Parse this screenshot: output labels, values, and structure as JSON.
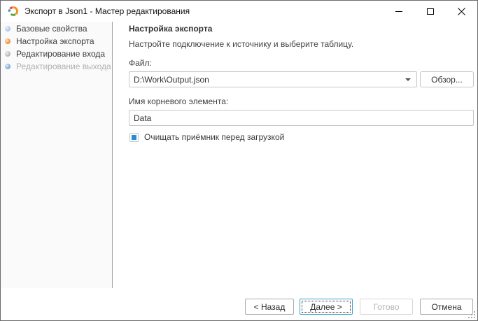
{
  "titlebar": {
    "title": "Экспорт в Json1 - Мастер редактирования",
    "icons": {
      "app": "app-logo-icon",
      "minimize": "minimize-icon",
      "maximize": "maximize-icon",
      "close": "close-icon"
    }
  },
  "sidebar": {
    "items": [
      {
        "label": "Базовые свойства",
        "state": "visited",
        "dot_color": "#a9c5e4"
      },
      {
        "label": "Настройка экспорта",
        "state": "current",
        "dot_color": "#ee8f2e"
      },
      {
        "label": "Редактирование входа",
        "state": "upcoming",
        "dot_color": "#b5b5b5"
      },
      {
        "label": "Редактирование выхода",
        "state": "disabled",
        "dot_color": "#79a9d9"
      }
    ]
  },
  "content": {
    "heading": "Настройка экспорта",
    "subtitle": "Настройте подключение к источнику и выберите таблицу.",
    "file_field": {
      "label": "Файл:",
      "value": "D:\\Work\\Output.json",
      "browse_label": "Обзор..."
    },
    "root_field": {
      "label": "Имя корневого элемента:",
      "value": "Data"
    },
    "checkbox": {
      "label": "Очищать приёмник перед загрузкой",
      "checked": true
    }
  },
  "footer": {
    "back_label": "< Назад",
    "next_label": "Далее >",
    "finish_label": "Готово",
    "cancel_label": "Отмена",
    "finish_enabled": false
  },
  "colors": {
    "window_border": "#6b6b6b",
    "sidebar_bg": "#fafafa",
    "input_border": "#c6c6c6",
    "next_button_border": "#3ba0d4",
    "checkbox_fill": "#2b8dd0",
    "dot_current": "#ee8f2e",
    "dot_visited": "#a9c5e4",
    "dot_upcoming": "#b5b5b5",
    "dot_disabled": "#79a9d9"
  }
}
